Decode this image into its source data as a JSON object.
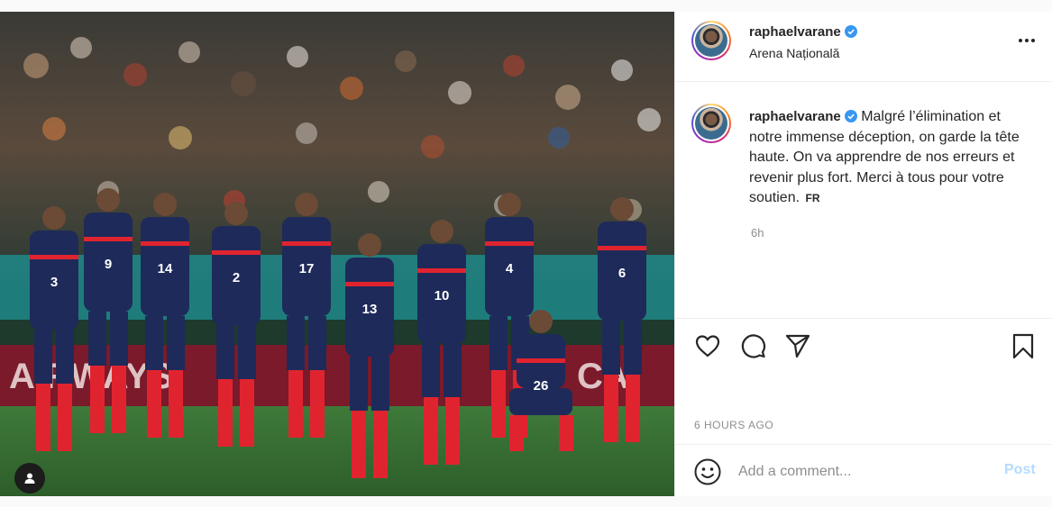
{
  "post": {
    "username": "raphaelvarane",
    "location": "Arena Națională",
    "caption_username": "raphaelvarane",
    "caption_text": "Malgré l’élimination et notre immense déception, on garde la tête haute. On va apprendre de nos erreurs et revenir plus fort. Merci à tous pour votre soutien.",
    "see_translation": "FR",
    "caption_time": "6h",
    "posted_ago": "6 HOURS AGO"
  },
  "comment": {
    "placeholder": "Add a comment...",
    "post_label": "Post"
  },
  "photo": {
    "shirt_numbers": [
      "3",
      "9",
      "14",
      "2",
      "17",
      "13",
      "10",
      "4",
      "26",
      "6"
    ],
    "banner_text": "AIRWAYS",
    "banner_text_right": "CA"
  },
  "colors": {
    "verified": "#3897f0",
    "post_button": "#b3dbff",
    "meta_text": "#8e8e8e",
    "kit_blue": "#1e2a5a",
    "kit_sock": "#e0242f"
  },
  "icons": {
    "tag": "user-tag-icon",
    "more": "more-options-icon",
    "like": "heart-icon",
    "comment": "comment-icon",
    "share": "send-icon",
    "save": "bookmark-icon",
    "emoji": "emoji-icon",
    "verified": "verified-badge-icon"
  }
}
